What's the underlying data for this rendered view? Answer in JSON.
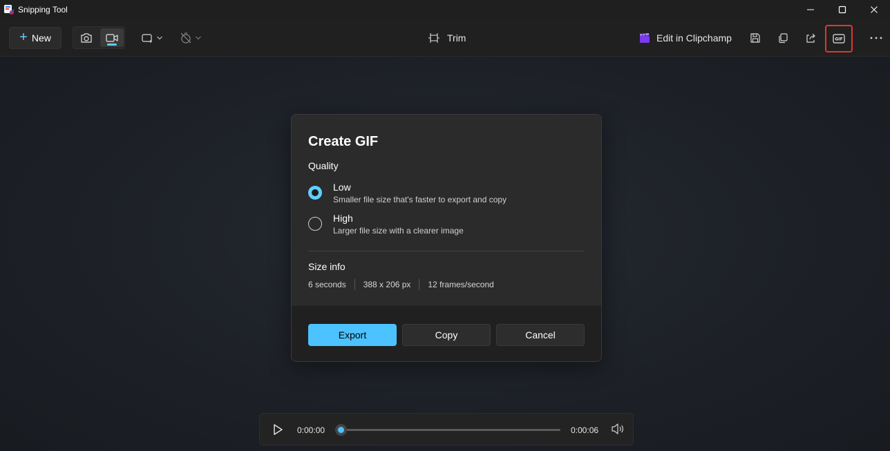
{
  "window": {
    "title": "Snipping Tool",
    "controls": [
      "minimize-icon",
      "maximize-icon",
      "close-icon"
    ]
  },
  "toolbar": {
    "new_label": "New",
    "modes": [
      "camera-icon",
      "video-camera-icon"
    ],
    "active_mode": "video-camera-icon",
    "shape_icon": "rectangle-select-icon",
    "timer_icon": "timer-off-icon",
    "trim_label": "Trim",
    "clipchamp_label": "Edit in Clipchamp",
    "actions": [
      "save-icon",
      "copy-icon",
      "share-icon",
      "gif-icon"
    ],
    "highlighted_action": "gif-icon",
    "highlight_color": "#e0392d",
    "more_icon": "more-icon"
  },
  "dialog": {
    "title": "Create GIF",
    "quality_label": "Quality",
    "options": [
      {
        "label": "Low",
        "description": "Smaller file size that's faster to export and copy",
        "checked": true
      },
      {
        "label": "High",
        "description": "Larger file size with a clearer image",
        "checked": false
      }
    ],
    "size_info_label": "Size info",
    "size_info": [
      "6 seconds",
      "388 x 206 px",
      "12 frames/second"
    ],
    "buttons": {
      "export": "Export",
      "copy": "Copy",
      "cancel": "Cancel"
    },
    "accent_color": "#4cc2ff"
  },
  "player": {
    "current_time": "0:00:00",
    "duration": "0:00:06",
    "progress": 0
  }
}
